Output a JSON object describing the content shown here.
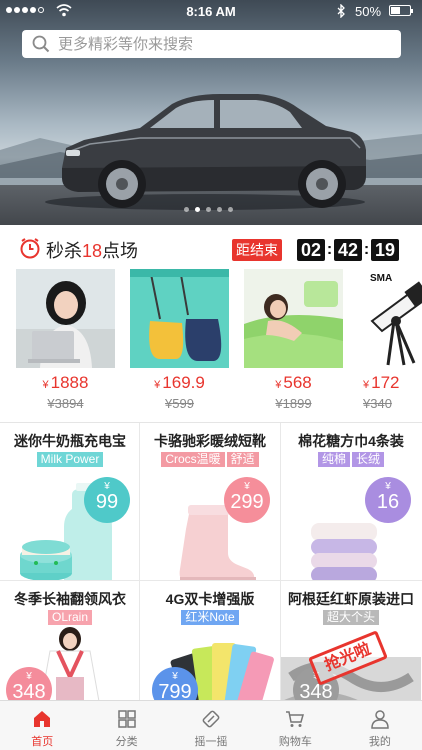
{
  "status_bar": {
    "time": "8:16 AM",
    "battery": "50%",
    "battery_level": 0.5
  },
  "search": {
    "placeholder": "更多精彩等你来搜索"
  },
  "banner": {
    "slide_count": 5,
    "active_slide": 2
  },
  "flash_sale": {
    "title_prefix": "秒杀",
    "title_hour": "18",
    "title_suffix": "点场",
    "ends_label": "距结束",
    "countdown": {
      "hours": "02",
      "minutes": "42",
      "seconds": "19"
    },
    "items": [
      {
        "currency": "¥",
        "price": "1888",
        "original_price": "¥3894"
      },
      {
        "currency": "¥",
        "price": "169.9",
        "original_price": "¥599"
      },
      {
        "currency": "¥",
        "price": "568",
        "original_price": "¥1899"
      },
      {
        "currency": "¥",
        "price": "172",
        "original_price": "¥340",
        "brand_text": "SMA"
      }
    ]
  },
  "products": [
    {
      "name": "迷你牛奶瓶充电宝",
      "tags": [
        "Milk Power"
      ],
      "currency": "¥",
      "price": "99",
      "tag_colors": [
        "#6fd6d6"
      ],
      "badge_color": "#4fc9c9"
    },
    {
      "name": "卡骆驰彩暖绒短靴",
      "tags": [
        "Crocs温暖",
        "舒适"
      ],
      "currency": "¥",
      "price": "299",
      "tag_colors": [
        "#f39aa3",
        "#f39aa3"
      ],
      "badge_color": "#f58e9a"
    },
    {
      "name": "棉花糖方巾4条装",
      "tags": [
        "纯棉",
        "长绒"
      ],
      "currency": "¥",
      "price": "16",
      "tag_colors": [
        "#b296e6",
        "#b296e6"
      ],
      "badge_color": "#a98de0"
    },
    {
      "name": "冬季长袖翻领风衣",
      "tags": [
        "OLrain"
      ],
      "currency": "¥",
      "price": "348",
      "tag_colors": [
        "#f7a3ad"
      ],
      "badge_color": "#f48c9b"
    },
    {
      "name": "4G双卡增强版",
      "tags": [
        "红米Note"
      ],
      "currency": "¥",
      "price": "799",
      "tag_colors": [
        "#6fa6f2"
      ],
      "badge_color": "#5b93ea"
    },
    {
      "name": "阿根廷红虾原装进口",
      "tags": [
        "超大个头"
      ],
      "currency": "¥",
      "price": "348",
      "tag_colors": [
        "#b9b9b9"
      ],
      "badge_color": "#9c9c9c",
      "stamp": "抢光啦"
    }
  ],
  "tabs": [
    {
      "label": "首页",
      "icon": "home-icon",
      "active": true
    },
    {
      "label": "分类",
      "icon": "category-grid-icon",
      "active": false
    },
    {
      "label": "摇一摇",
      "icon": "shake-icon",
      "active": false
    },
    {
      "label": "购物车",
      "icon": "cart-icon",
      "active": false
    },
    {
      "label": "我的",
      "icon": "user-icon",
      "active": false
    }
  ],
  "colors": {
    "accent": "#e8352e"
  }
}
